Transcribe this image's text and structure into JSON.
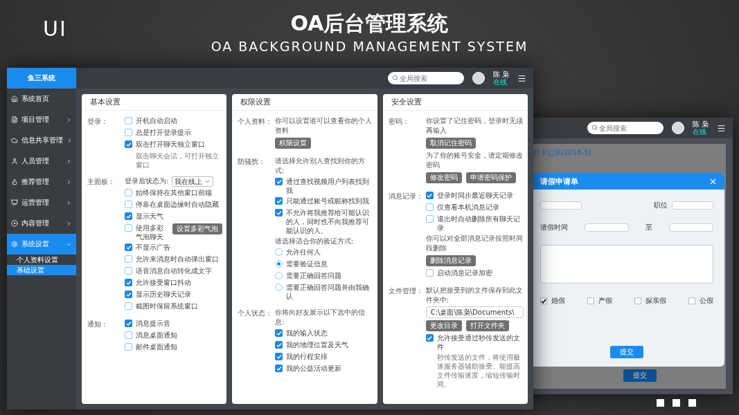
{
  "header": {
    "badge": "UI",
    "title": "OA后台管理系统",
    "subtitle": "OA BACKGROUND MANAGEMENT SYSTEM"
  },
  "main_window": {
    "logo": "鱼三系统",
    "search": {
      "placeholder": "全局搜索"
    },
    "user": {
      "name": "陈 枭",
      "status": "在线"
    },
    "sidebar": [
      {
        "label": "系统首页",
        "has_children": false,
        "selected": false
      },
      {
        "label": "项目管理",
        "has_children": true,
        "expanded": false,
        "selected": false
      },
      {
        "label": "信息共享管理",
        "has_children": true,
        "expanded": false,
        "selected": false
      },
      {
        "label": "人员管理",
        "has_children": true,
        "expanded": false,
        "selected": false
      },
      {
        "label": "推荐管理",
        "has_children": true,
        "expanded": false,
        "selected": false
      },
      {
        "label": "运营管理",
        "has_children": true,
        "expanded": false,
        "selected": false
      },
      {
        "label": "内容管理",
        "has_children": true,
        "expanded": false,
        "selected": false
      },
      {
        "label": "系统设置",
        "has_children": true,
        "expanded": true,
        "selected": true,
        "children": [
          {
            "label": "个人资料设置",
            "selected": false
          },
          {
            "label": "基础设置",
            "selected": true
          }
        ]
      }
    ],
    "cards": [
      {
        "title": "基本设置",
        "sections": [
          {
            "label": "登录：",
            "items": [
              {
                "kind": "checkbox",
                "label": "开机自动启动",
                "checked": false
              },
              {
                "kind": "checkbox",
                "label": "总是打开登录提示",
                "checked": false
              },
              {
                "kind": "checkbox",
                "label": "双击打开聊天独立窗口",
                "checked": true,
                "note": "双击聊天会话，可打开独立窗口"
              }
            ]
          },
          {
            "label": "主面板：",
            "items": [
              {
                "kind": "select",
                "label": "登录后状态为:",
                "value": "我在线上"
              },
              {
                "kind": "checkbox",
                "label": "始终保持在其他窗口前端",
                "checked": false
              },
              {
                "kind": "checkbox",
                "label": "停靠在桌面边缘时自动隐藏",
                "checked": false
              },
              {
                "kind": "checkbox",
                "label": "显示天气",
                "checked": true
              },
              {
                "kind": "checkbox",
                "label": "使用多彩气泡聊天",
                "checked": false,
                "button": "设置多彩气泡"
              },
              {
                "kind": "checkbox",
                "label": "不显示广告",
                "checked": true
              },
              {
                "kind": "checkbox",
                "label": "允许来消息时自动弹出窗口",
                "checked": false
              },
              {
                "kind": "checkbox",
                "label": "语音消息自动转化成文字",
                "checked": false
              },
              {
                "kind": "checkbox",
                "label": "允许接受窗口抖动",
                "checked": true
              },
              {
                "kind": "checkbox",
                "label": "显示历史聊天记录",
                "checked": true
              },
              {
                "kind": "checkbox",
                "label": "截图时保留系统窗口",
                "checked": false
              }
            ]
          },
          {
            "label": "通知：",
            "items": [
              {
                "kind": "checkbox",
                "label": "消息提示音",
                "checked": true
              },
              {
                "kind": "checkbox",
                "label": "消息桌面通知",
                "checked": false
              },
              {
                "kind": "checkbox",
                "label": "邮件桌面通知",
                "checked": false
              }
            ]
          }
        ]
      },
      {
        "title": "权限设置",
        "sections": [
          {
            "label": "个人资料：",
            "items": [
              {
                "kind": "text",
                "text": "你可以设置谁可以查看你的个人资料"
              },
              {
                "kind": "buttons",
                "buttons": [
                  "权限设置"
                ]
              }
            ]
          },
          {
            "label": "防骚扰：",
            "items": [
              {
                "kind": "text",
                "text": "请选择允许别人查找到你的方式:"
              },
              {
                "kind": "checkbox",
                "label": "通过查找视频用户列表找到我",
                "checked": true
              },
              {
                "kind": "checkbox",
                "label": "只能通过账号或昵称找到我",
                "checked": true
              },
              {
                "kind": "checkbox",
                "label": "不允许将我推荐给可能认识的人，同时也不向我推荐可能认识的人。",
                "checked": true
              },
              {
                "kind": "text",
                "text": "请选择适合你的验证方式:"
              },
              {
                "kind": "radio",
                "label": "允许任何人",
                "selected": false
              },
              {
                "kind": "radio",
                "label": "需要验证信息",
                "selected": true
              },
              {
                "kind": "radio",
                "label": "需要正确回答问题",
                "selected": false
              },
              {
                "kind": "radio",
                "label": "需要正确回答问题并由我确认",
                "selected": false
              }
            ]
          },
          {
            "label": "个人状态：",
            "items": [
              {
                "kind": "text",
                "text": "你将向好友展示以下选中的信息:"
              },
              {
                "kind": "checkbox",
                "label": "我的输入状态",
                "checked": true
              },
              {
                "kind": "checkbox",
                "label": "我的地理位置及天气",
                "checked": true
              },
              {
                "kind": "checkbox",
                "label": "我的行程安排",
                "checked": true
              },
              {
                "kind": "checkbox",
                "label": "我的公益活动更新",
                "checked": true
              }
            ]
          }
        ]
      },
      {
        "title": "安全设置",
        "sections": [
          {
            "label": "密码：",
            "items": [
              {
                "kind": "text",
                "text": "你设置了记住密码，登录时无须再输入"
              },
              {
                "kind": "buttons",
                "buttons": [
                  "取消记住密码"
                ]
              },
              {
                "kind": "text",
                "text": "为了你的账号安全，请定期修改密码"
              },
              {
                "kind": "buttons",
                "buttons": [
                  "修改密码",
                  "申请密码保护"
                ]
              }
            ]
          },
          {
            "label": "消息记录：",
            "items": [
              {
                "kind": "checkbox",
                "label": "登录时同步最近聊天记录",
                "checked": true
              },
              {
                "kind": "checkbox",
                "label": "仅查看本机消息记录",
                "checked": false
              },
              {
                "kind": "checkbox",
                "label": "退出时自动删除所有聊天记录",
                "checked": false
              },
              {
                "kind": "text",
                "text": "你可以对全部消息记录按照时间段删除"
              },
              {
                "kind": "buttons",
                "buttons": [
                  "删除消息记录"
                ]
              },
              {
                "kind": "checkbox",
                "label": "启动消息记录加密",
                "checked": false
              }
            ]
          },
          {
            "label": "文件管理：",
            "items": [
              {
                "kind": "text",
                "text": "默认把接受到的文件保存到此文件夹中:"
              },
              {
                "kind": "path",
                "value": "C:\\桌面\\陈枭\\Documents\\"
              },
              {
                "kind": "buttons",
                "buttons": [
                  "更改目录",
                  "打开文件夹"
                ]
              },
              {
                "kind": "checkbox",
                "label": "允许接受通过秒传发送的文件",
                "checked": true,
                "note": "秒传发送的文件，将使用极速服务器辅助接受。能提高文件传输速度，缩短传输时间。"
              }
            ]
          }
        ]
      }
    ]
  },
  "back_window": {
    "search": {
      "placeholder": "全局搜索"
    },
    "user": {
      "name": "陈 枭",
      "status": "在线"
    },
    "record_title": "打卡记录(2018-5)",
    "submit": "提交",
    "modal": {
      "title": "请假申请单",
      "position_label": "职位",
      "time_label": "请假时间",
      "to_label": "至",
      "leave_types": [
        {
          "label": "婚假",
          "checked": true
        },
        {
          "label": "产假",
          "checked": false
        },
        {
          "label": "探亲假",
          "checked": false
        },
        {
          "label": "公假",
          "checked": false
        }
      ],
      "submit": "提交"
    }
  }
}
